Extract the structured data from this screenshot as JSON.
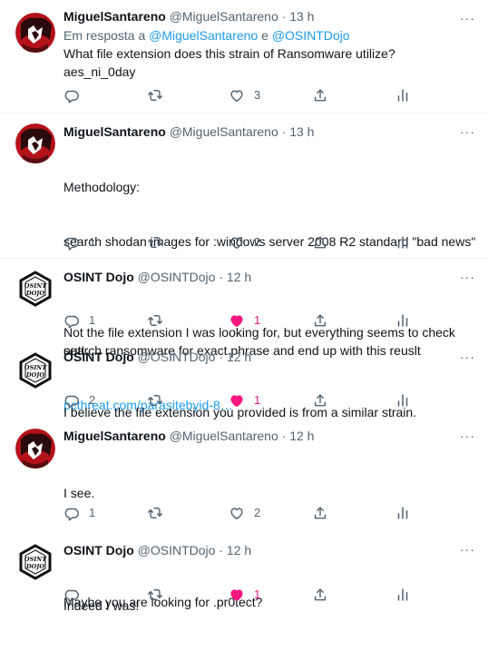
{
  "accent": "#1d9bf0",
  "like_color": "#f91880",
  "tweets": [
    {
      "name": "MiguelSantareno",
      "handle": "@MiguelSantareno",
      "dot": "·",
      "time": "13 h",
      "reply_prefix": "Em resposta a ",
      "reply_user1": "@MiguelSantareno",
      "reply_join": " e ",
      "reply_user2": "@OSINTDojo",
      "lines": [
        "What file extension does this strain of Ransomware utilize?",
        "aes_ni_0day"
      ],
      "replies": "",
      "likes": "3",
      "liked": false
    },
    {
      "name": "MiguelSantareno",
      "handle": "@MiguelSantareno",
      "dot": "·",
      "time": "13 h",
      "lines": [
        "Methodology:",
        "search shodan images for :windows server 2008 R2 standard \"bad news\"",
        "",
        "search ransomware for exact phrase and end up with this reuslt"
      ],
      "link": "pcthreat.com/parasitebyid-8…",
      "replies": "1",
      "likes": "2",
      "liked": false
    },
    {
      "name": "OSINT Dojo",
      "handle": "@OSINTDojo",
      "dot": "·",
      "time": "12 h",
      "lines": [
        "Not the file extension I was looking for, but everything seems to check out!"
      ],
      "replies": "1",
      "likes": "1",
      "liked": true
    },
    {
      "name": "OSINT Dojo",
      "handle": "@OSINTDojo",
      "dot": "·",
      "time": "12 h",
      "lines": [
        "I believe the file extension you provided is from a similar strain."
      ],
      "replies": "2",
      "likes": "1",
      "liked": true
    },
    {
      "name": "MiguelSantareno",
      "handle": "@MiguelSantareno",
      "dot": "·",
      "time": "12 h",
      "lines": [
        "I see.",
        "",
        "Maybe you are looking for .pr0tect?"
      ],
      "replies": "1",
      "likes": "2",
      "liked": false
    },
    {
      "name": "OSINT Dojo",
      "handle": "@OSINTDojo",
      "dot": "·",
      "time": "12 h",
      "lines": [
        "Indeed I was!"
      ],
      "replies": "",
      "likes": "1",
      "liked": true
    }
  ],
  "icons": {
    "more": "more-icon",
    "reply": "reply-icon",
    "retweet": "retweet-icon",
    "like": "heart-icon",
    "share": "share-icon",
    "stats": "analytics-icon"
  },
  "more_glyph": "···"
}
